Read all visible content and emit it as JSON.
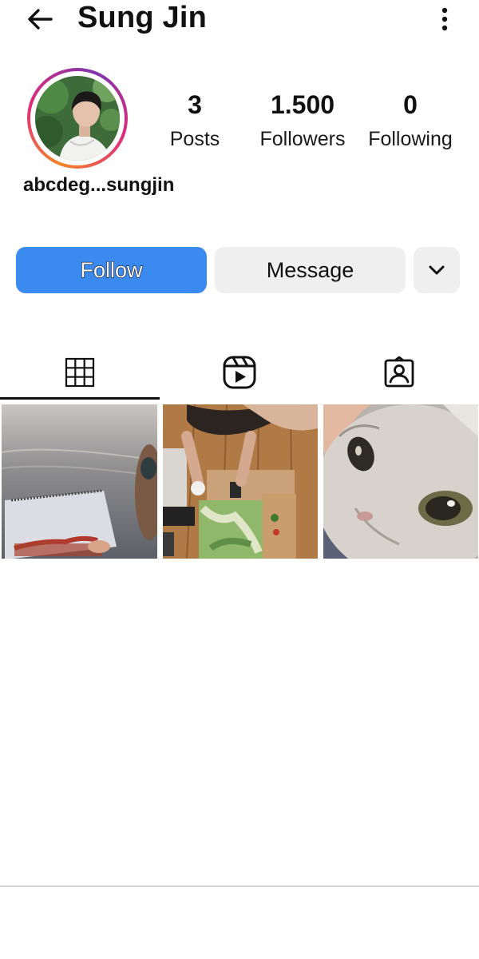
{
  "header": {
    "title": "Sung Jin",
    "back_icon": "arrow-left-icon",
    "more_icon": "more-vertical-icon"
  },
  "profile": {
    "username": "abcdeg...sungjin",
    "stats": {
      "posts": {
        "value": "3",
        "label": "Posts"
      },
      "followers": {
        "value": "1.500",
        "label": "Followers"
      },
      "following": {
        "value": "0",
        "label": "Following"
      }
    }
  },
  "actions": {
    "follow_label": "Follow",
    "message_label": "Message",
    "dropdown_icon": "chevron-down-icon"
  },
  "tabs": [
    {
      "icon": "grid-icon",
      "active": true
    },
    {
      "icon": "reels-icon",
      "active": false
    },
    {
      "icon": "tagged-icon",
      "active": false
    }
  ],
  "colors": {
    "follow_button": "#3a8af0",
    "secondary_button": "#efefef",
    "story_ring_start": "#f58529",
    "story_ring_end": "#8134af"
  }
}
